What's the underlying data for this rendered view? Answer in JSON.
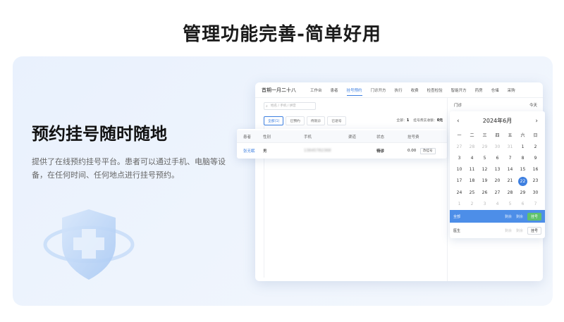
{
  "page": {
    "title": "管理功能完善-简单好用"
  },
  "feature": {
    "title": "预约挂号随时随地",
    "description": "提供了在线预约挂号平台。患者可以通过手机、电脑等设备，在任何时间、任何地点进行挂号预约。"
  },
  "app": {
    "date": "首期一月二十八",
    "nav": [
      "工作台",
      "患者",
      "挂号预约",
      "门诊开方",
      "执行",
      "收费",
      "检查检验",
      "智能开方",
      "药房",
      "仓储",
      "采购"
    ],
    "active_nav_index": 2,
    "search_placeholder": "姓名 / 手机 / 拼音",
    "filters": [
      "全部(1)",
      "已预约",
      "待就诊",
      "已退号"
    ],
    "active_filter_index": 0,
    "summary": {
      "total_label": "全部：",
      "total_value": "1",
      "fee_label": "挂号费实收额：",
      "fee_value": "0元"
    },
    "table": {
      "headers": [
        "患者",
        "性别",
        "手机",
        "渠道",
        "状态",
        "挂号费"
      ],
      "rows": [
        {
          "patient": "张无眠",
          "gender": "男",
          "phone": "13645782368",
          "channel": "",
          "status": "待诊",
          "fee": "0.00",
          "fee_action": "改挂号"
        }
      ]
    },
    "calendar": {
      "clinic_label": "门诊",
      "today_label": "今天",
      "month": "2024年6月",
      "weekdays": [
        "一",
        "二",
        "三",
        "四",
        "五",
        "六",
        "日"
      ],
      "weeks": [
        [
          "27",
          "28",
          "29",
          "30",
          "31",
          "1",
          "2"
        ],
        [
          "3",
          "4",
          "5",
          "6",
          "7",
          "8",
          "9"
        ],
        [
          "10",
          "11",
          "12",
          "13",
          "14",
          "15",
          "16"
        ],
        [
          "17",
          "18",
          "19",
          "20",
          "21",
          "22",
          "23"
        ],
        [
          "24",
          "25",
          "26",
          "27",
          "28",
          "29",
          "30"
        ],
        [
          "1",
          "2",
          "3",
          "4",
          "5",
          "6",
          "7"
        ]
      ],
      "selected": "22",
      "departments": [
        {
          "name": "全部",
          "am": "剩余",
          "pm": "剩余",
          "action": "挂号"
        },
        {
          "name": "医生",
          "am": "剩余",
          "pm": "剩余",
          "action": "挂号"
        }
      ]
    }
  },
  "colors": {
    "accent": "#3d7fe0",
    "success": "#5fc26b"
  }
}
